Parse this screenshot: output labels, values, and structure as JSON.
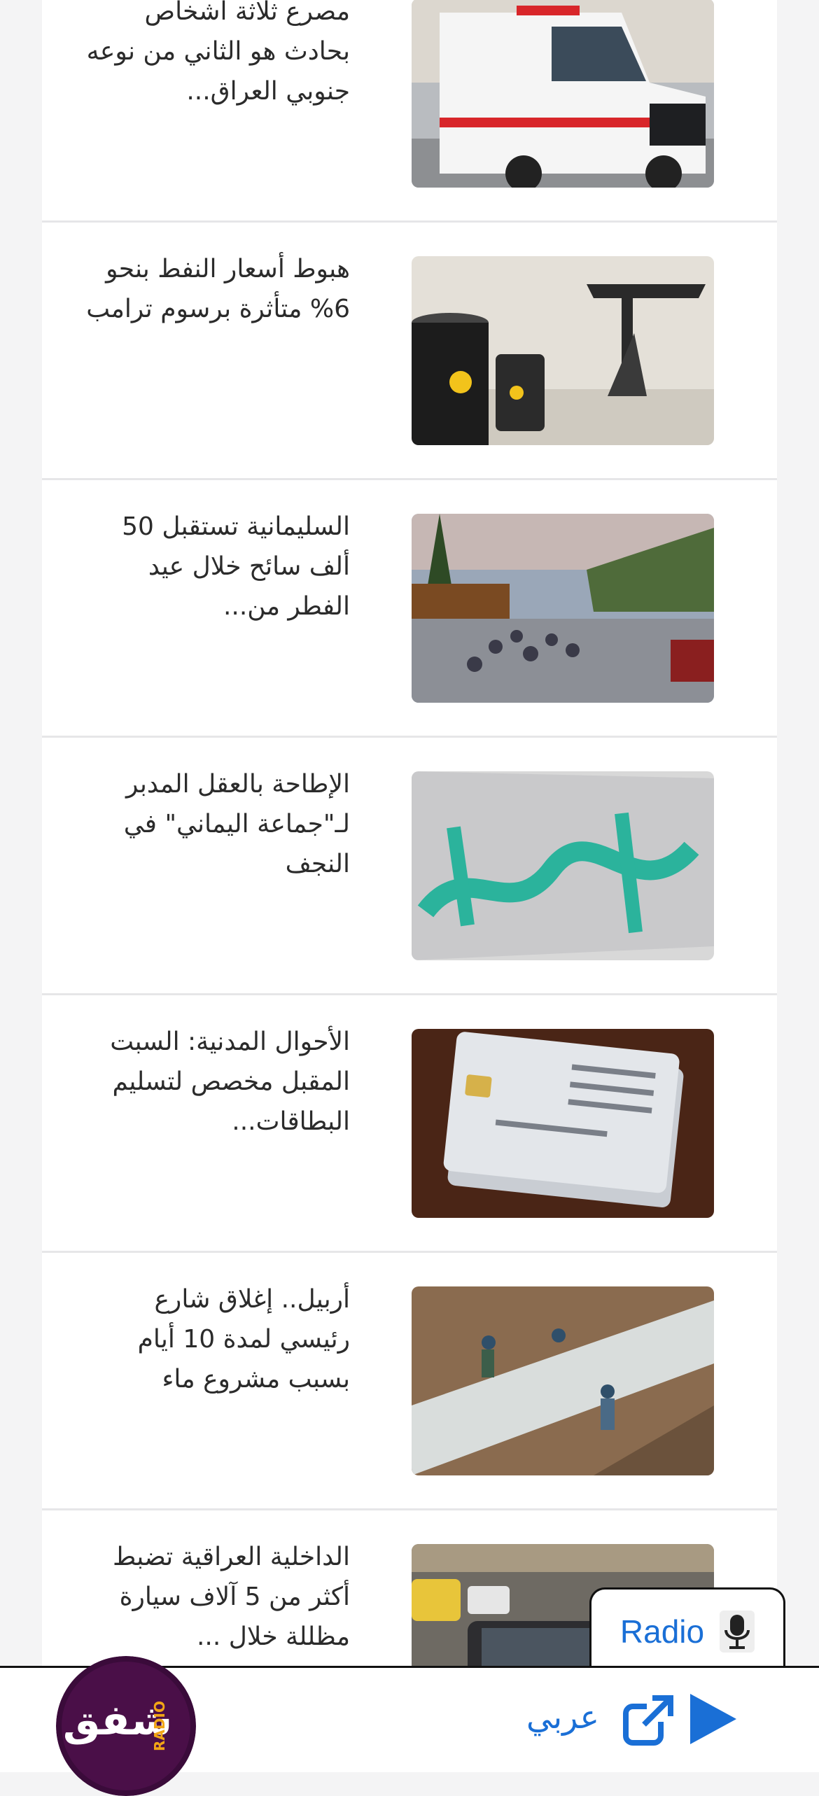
{
  "news": [
    {
      "title": "مصرع ثلاثة اشخاص بحادث هو الثاني من نوعه جنوبي العراق...",
      "image": "ambulance"
    },
    {
      "title": "هبوط أسعار النفط بنحو 6% متأثرة برسوم ترامب",
      "image": "oil-barrels"
    },
    {
      "title": "السليمانية تستقبل 50 ألف سائح خلال عيد الفطر من...",
      "image": "crowd-street"
    },
    {
      "title": "الإطاحة بالعقل المدبر لـ\"جماعة اليماني\" في النجف",
      "image": "green-banner"
    },
    {
      "title": "الأحوال المدنية: السبت المقبل مخصص لتسليم البطاقات...",
      "image": "id-cards"
    },
    {
      "title": "أربيل.. إغلاق شارع رئيسي لمدة 10 أيام بسبب مشروع ماء",
      "image": "water-pipe"
    },
    {
      "title": "الداخلية العراقية تضبط أكثر من 5 آلاف سيارة مظللة خلال ...",
      "image": "traffic-cars"
    }
  ],
  "radio_tab": {
    "label": "Radio",
    "icon": "microphone-icon"
  },
  "player": {
    "language_label": "عربي",
    "external_icon": "external-link-icon",
    "play_icon": "play-icon"
  },
  "logo": {
    "text": "شفق",
    "sub": "RADIO"
  },
  "colors": {
    "accent": "#1a6fd6",
    "logo_bg": "#3a0b3a",
    "logo_accent": "#f2a516"
  }
}
